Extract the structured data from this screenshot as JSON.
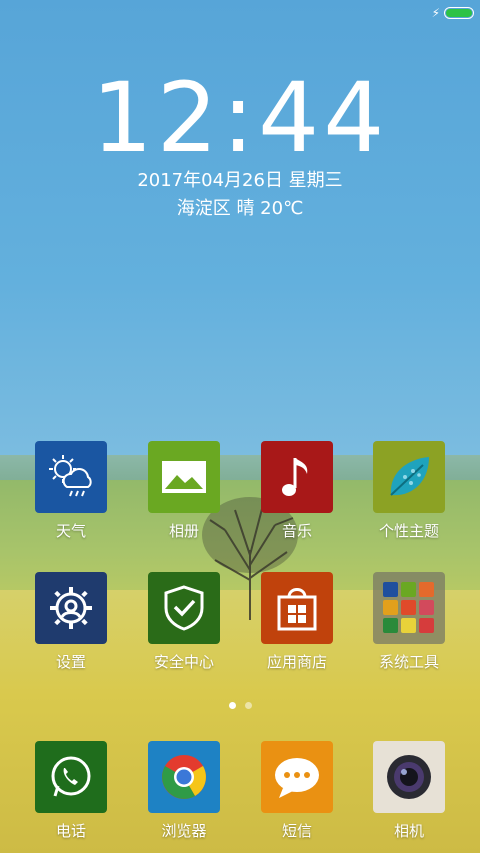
{
  "status_bar": {
    "battery_color": "#2ec246"
  },
  "lock": {
    "time": "12:44",
    "date": "2017年04月26日 星期三",
    "weather": "海淀区 晴 20℃"
  },
  "apps": [
    {
      "label": "天气",
      "icon": "weather-icon",
      "color": "#1a56a2"
    },
    {
      "label": "相册",
      "icon": "gallery-icon",
      "color": "#6aa822"
    },
    {
      "label": "音乐",
      "icon": "music-icon",
      "color": "#a81818"
    },
    {
      "label": "个性主题",
      "icon": "theme-leaf-icon",
      "color": "#8ca224"
    },
    {
      "label": "设置",
      "icon": "gear-icon",
      "color": "#1f3b6e"
    },
    {
      "label": "安全中心",
      "icon": "shield-icon",
      "color": "#2a6b18"
    },
    {
      "label": "应用商店",
      "icon": "store-bag-icon",
      "color": "#c0420c"
    },
    {
      "label": "系统工具",
      "icon": "folder-icon",
      "color": "#8a8a66"
    }
  ],
  "pager": {
    "pages": 2,
    "active": 1
  },
  "dock": [
    {
      "label": "电话",
      "icon": "phone-icon",
      "color": "#1f6d1c"
    },
    {
      "label": "浏览器",
      "icon": "browser-icon",
      "color": "#1e82c4"
    },
    {
      "label": "短信",
      "icon": "sms-icon",
      "color": "#ea9112"
    },
    {
      "label": "相机",
      "icon": "camera-icon",
      "color": "#e7e1d6"
    }
  ]
}
